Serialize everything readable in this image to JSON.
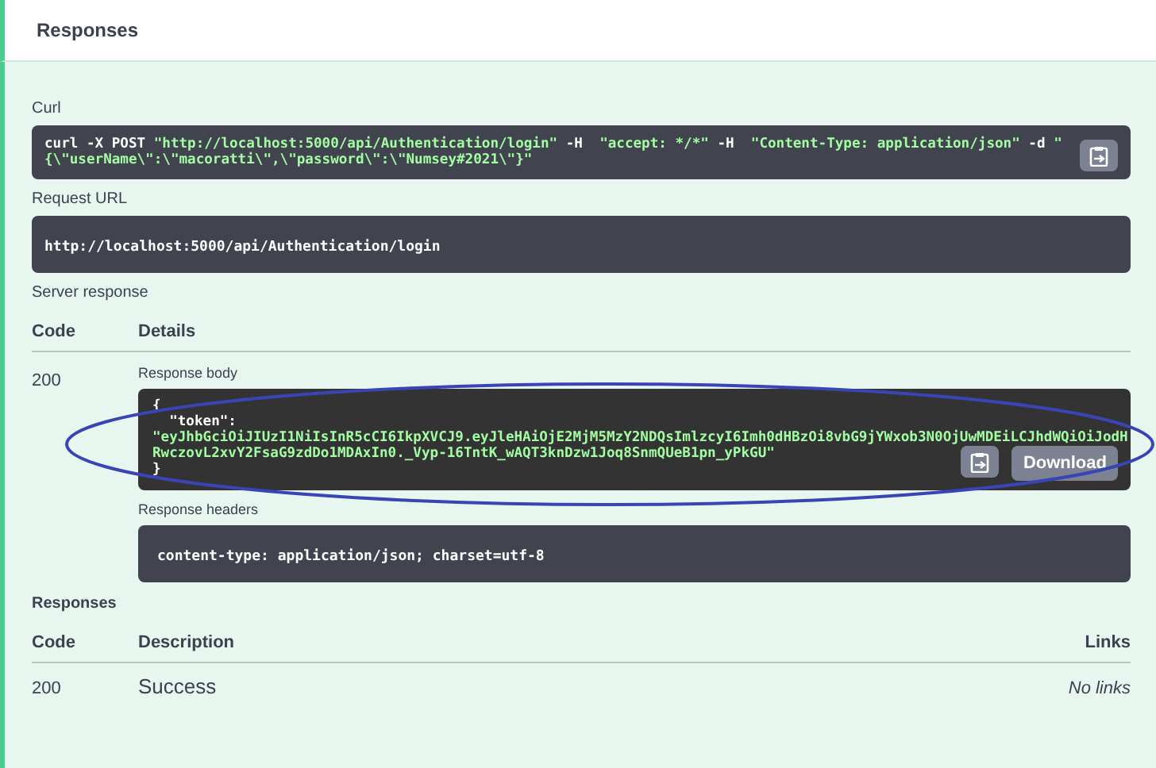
{
  "header": {
    "title": "Responses"
  },
  "curl": {
    "label": "Curl",
    "lines": [
      [
        {
          "t": "curl -X POST ",
          "kind": "plain"
        },
        {
          "t": "\"http://localhost:5000/api/Authentication/login\"",
          "kind": "string"
        },
        {
          "t": " -H  ",
          "kind": "plain"
        },
        {
          "t": "\"accept: */*\"",
          "kind": "string"
        },
        {
          "t": " -H  ",
          "kind": "plain"
        },
        {
          "t": "\"Content-Type: application/json\"",
          "kind": "string"
        },
        {
          "t": " -d ",
          "kind": "plain"
        },
        {
          "t": "\"",
          "kind": "string"
        }
      ],
      [
        {
          "t": "{\\\"userName\\\":\\\"macoratti\\\",\\\"password\\\":\\\"Numsey#2021\\\"}\"",
          "kind": "string"
        }
      ]
    ]
  },
  "request_url": {
    "label": "Request URL",
    "value": "http://localhost:5000/api/Authentication/login"
  },
  "server_response": {
    "label": "Server response",
    "columns": [
      "Code",
      "Details"
    ],
    "code": "200",
    "body_label": "Response body",
    "body_lines": [
      [
        {
          "t": "{",
          "kind": "plain"
        }
      ],
      [
        {
          "t": "  \"token\":",
          "kind": "plain"
        }
      ],
      [
        {
          "t": "\"eyJhbGciOiJIUzI1NiIsInR5cCI6IkpXVCJ9.eyJleHAiOjE2MjM5MzY2NDQsImlzcyI6Imh0dHBzOi8vbG9jYWxob3N0OjUwMDEiLCJhdWQiOiJodH",
          "kind": "string"
        }
      ],
      [
        {
          "t": "RwczovL2xvY2FsaG9zdDo1MDAxIn0._Vyp-16TntK_wAQT3knDzw1Joq8SnmQUeB1pn_yPkGU\"",
          "kind": "string"
        }
      ],
      [
        {
          "t": "}",
          "kind": "plain"
        }
      ]
    ],
    "download": "Download",
    "headers_label": "Response headers",
    "headers_value": "content-type: application/json; charset=utf-8"
  },
  "responses": {
    "label": "Responses",
    "columns": [
      "Code",
      "Description",
      "Links"
    ],
    "rows": [
      {
        "code": "200",
        "description": "Success",
        "links": "No links"
      }
    ]
  }
}
